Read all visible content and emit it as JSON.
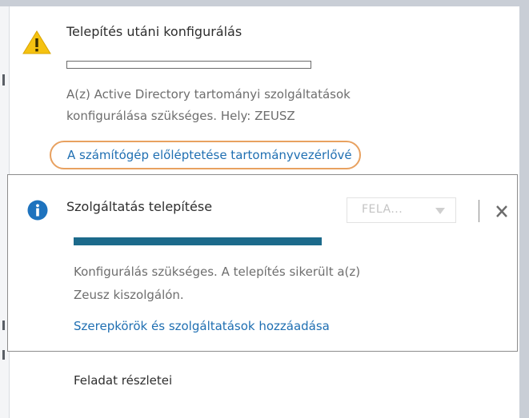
{
  "notification_warning": {
    "icon": "warning-icon",
    "title": "Telepítés utáni konfigurálás",
    "message_line1": "A(z) Active Directory tartományi szolgáltatások",
    "message_line2": "konfigurálása szükséges. Hely: ZEUSZ",
    "link": "A számítógép előléptetése tartományvezérlővé",
    "progress": 0,
    "highlight_color": "#e8a160"
  },
  "notification_info": {
    "icon": "info-icon",
    "title": "Szolgáltatás telepítése",
    "task_dropdown": "FELA...",
    "progress": 1.0,
    "progress_color": "#1c6a8b",
    "message_line1": "Konfigurálás szükséges. A telepítés sikerült a(z)",
    "message_line2": "Zeusz kiszolgálón.",
    "link": "Szerepkörök és szolgáltatások hozzáadása"
  },
  "footer": {
    "task_details": "Feladat részletei"
  },
  "colors": {
    "link": "#1f6fb2",
    "warning": "#f5c211",
    "info": "#1e73be"
  }
}
